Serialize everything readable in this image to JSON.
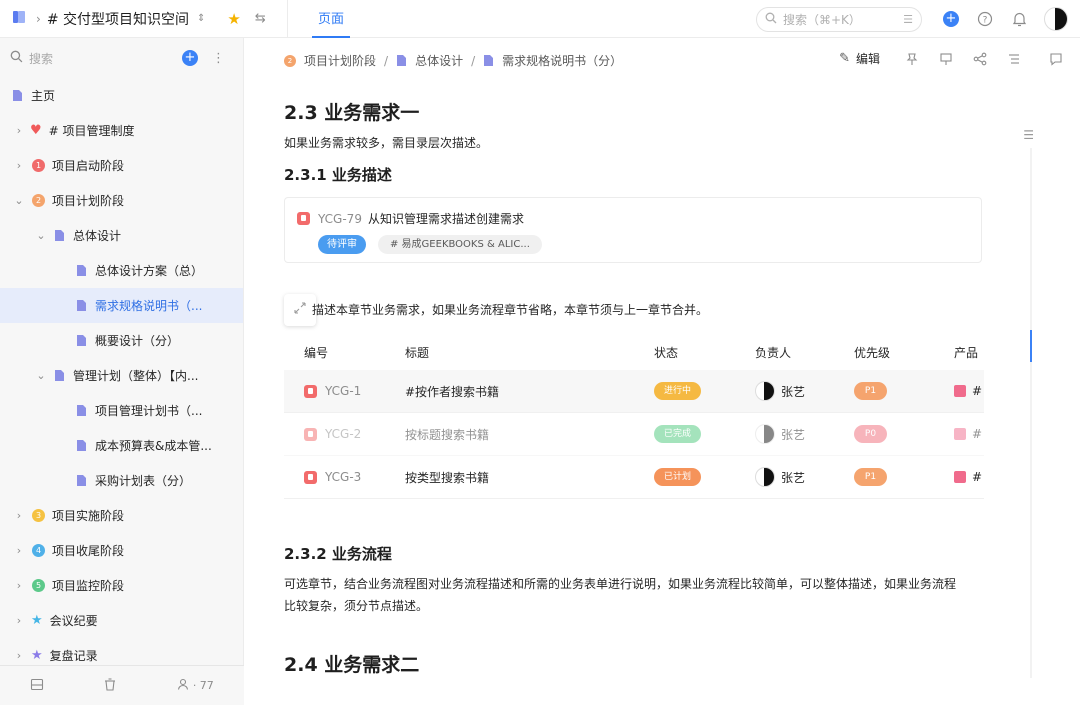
{
  "topbar": {
    "space_title": "# 交付型项目知识空间",
    "tab_label": "页面",
    "search_placeholder": "搜索（⌘+K）"
  },
  "sidebar": {
    "search_placeholder": "搜索",
    "items": [
      {
        "label": "主页"
      },
      {
        "label": "# 项目管理制度"
      },
      {
        "label": "项目启动阶段",
        "badge": "1"
      },
      {
        "label": "项目计划阶段",
        "badge": "2"
      },
      {
        "label": "总体设计"
      },
      {
        "label": "总体设计方案（总）"
      },
      {
        "label": "需求规格说明书（..."
      },
      {
        "label": "概要设计（分）"
      },
      {
        "label": "管理计划（整体）【内..."
      },
      {
        "label": "项目管理计划书（..."
      },
      {
        "label": "成本预算表&成本管..."
      },
      {
        "label": "采购计划表（分）"
      },
      {
        "label": "项目实施阶段",
        "badge": "3"
      },
      {
        "label": "项目收尾阶段",
        "badge": "4"
      },
      {
        "label": "项目监控阶段",
        "badge": "5"
      },
      {
        "label": "会议纪要"
      },
      {
        "label": "复盘记录"
      }
    ],
    "member_count": "· 77"
  },
  "breadcrumb": {
    "items": [
      "项目计划阶段",
      "总体设计",
      "需求规格说明书（分）"
    ],
    "stage_badge": "2"
  },
  "toolbar": {
    "edit_label": "编辑"
  },
  "content": {
    "h_23": "2.3  业务需求一",
    "p_23": "如果业务需求较多，需目录层次描述。",
    "h_231": "2.3.1    业务描述",
    "card": {
      "id": "YCG-79",
      "title": "从知识管理需求描述创建需求",
      "status_tag": "待评审",
      "group_tag": "# 易成GEEKBOOKS & ALIC..."
    },
    "p_231": "描述本章节业务需求，如果业务流程章节省略，本章节须与上一章节合并。",
    "h_232": "2.3.2    业务流程",
    "p_232_line1": "可选章节，结合业务流程图对业务流程描述和所需的业务表单进行说明，如果业务流程比较简单，可以整体描述，如果业务流程",
    "p_232_line2": "比较复杂，须分节点描述。",
    "h_24": "2.4  业务需求二"
  },
  "table": {
    "headers": {
      "id": "编号",
      "title": "标题",
      "status": "状态",
      "owner": "负责人",
      "priority": "优先级",
      "product": "产品"
    },
    "rows": [
      {
        "id": "YCG-1",
        "title": "#按作者搜索书籍",
        "status": "进行中",
        "status_color": "#f5b942",
        "owner": "张艺",
        "priority": "P1",
        "priority_color": "#f5a46e",
        "product": "#"
      },
      {
        "id": "YCG-2",
        "title": "按标题搜索书籍",
        "status": "已完成",
        "status_color": "#4cc97b",
        "owner": "张艺",
        "priority": "P0",
        "priority_color": "#f06b7a",
        "product": "#"
      },
      {
        "id": "YCG-3",
        "title": "按类型搜索书籍",
        "status": "已计划",
        "status_color": "#f5935a",
        "owner": "张艺",
        "priority": "P1",
        "priority_color": "#f5a46e",
        "product": "#"
      }
    ]
  },
  "colors": {
    "accent": "#2f7bf5",
    "sidebar_active": "#e6ecfb"
  }
}
